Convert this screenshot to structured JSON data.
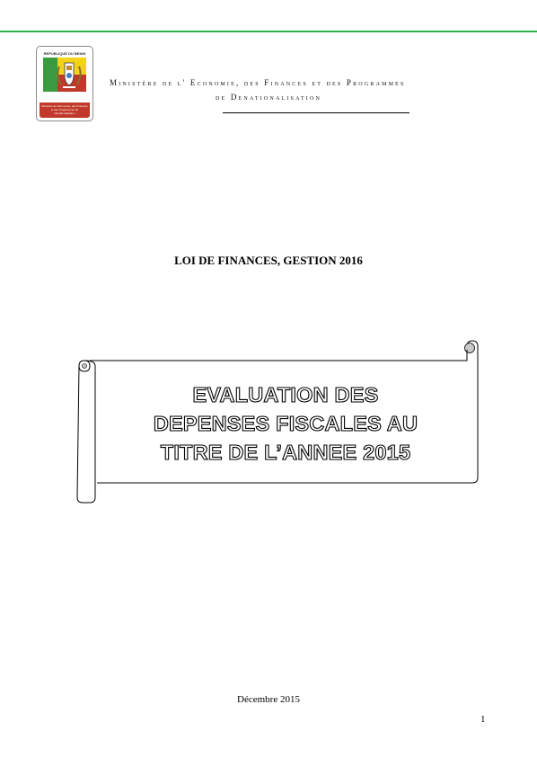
{
  "header": {
    "logo": {
      "top_text": "REPUBLIQUE DU BENIN",
      "acronym": "MEFPD",
      "band_text": "Ministère de l'Economie, des Finances et des Programmes de Dénationalisation"
    },
    "ministry_line1": "Ministère de l' Economie, des Finances et des Programmes",
    "ministry_line2": "de Denationalisation"
  },
  "document": {
    "law_title": "LOI DE FINANCES, GESTION 2016",
    "main_title_lines": [
      "EVALUATION DES",
      "DEPENSES FISCALES AU",
      "TITRE DE L’ANNEE 2015"
    ],
    "date": "Décembre 2015",
    "page_number": "1"
  },
  "colors": {
    "rule_green": "#2fb24c",
    "logo_green": "#3a9a3f",
    "logo_yellow": "#f3d21a",
    "logo_red": "#c0392b"
  }
}
